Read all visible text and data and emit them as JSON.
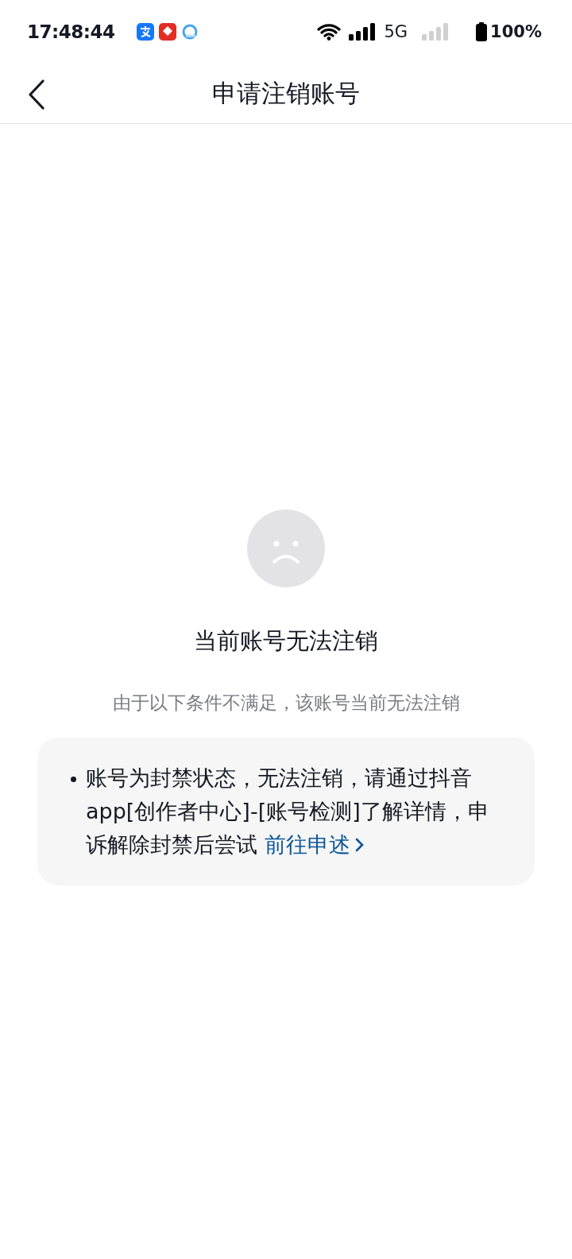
{
  "status_bar": {
    "time": "17:48:44",
    "network": "5G",
    "battery": "100%"
  },
  "nav": {
    "title": "申请注销账号"
  },
  "result": {
    "title": "当前账号无法注销",
    "subtitle": "由于以下条件不满足，该账号当前无法注销"
  },
  "reasons": [
    {
      "text": "账号为封禁状态，无法注销，请通过抖音app[创作者中心]-[账号检测]了解详情，申诉解除封禁后尝试",
      "link": "前往申述"
    }
  ]
}
